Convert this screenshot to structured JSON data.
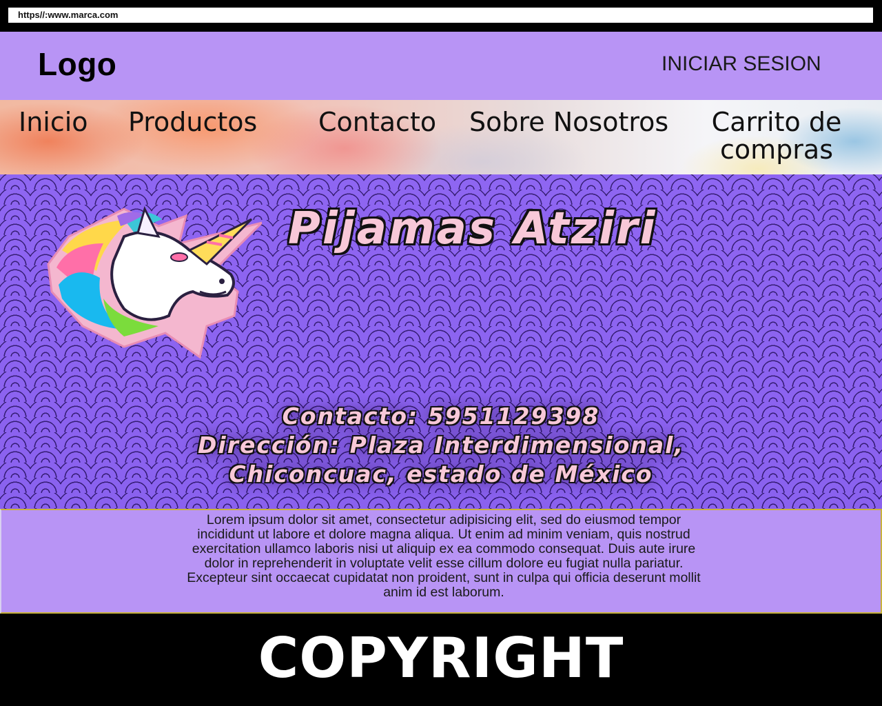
{
  "browser": {
    "url": "https//:www.marca.com"
  },
  "header": {
    "logo": "Logo",
    "login": "INICIAR SESION"
  },
  "nav": {
    "items": [
      {
        "label": "Inicio"
      },
      {
        "label": "Productos"
      },
      {
        "label": "Contacto"
      },
      {
        "label": "Sobre Nosotros"
      },
      {
        "label": "Carrito de compras"
      }
    ]
  },
  "hero": {
    "title": "Pijamas Atziri",
    "contact_line": "Contacto: 5951129398",
    "address_line1": "Dirección: Plaza Interdimensional,",
    "address_line2": "Chiconcuac, estado de México",
    "icon": "unicorn-logo-icon"
  },
  "content": {
    "lorem": "Lorem ipsum dolor sit amet, consectetur adipisicing elit, sed do eiusmod tempor incididunt ut labore et dolore magna aliqua. Ut enim ad minim veniam, quis nostrud exercitation ullamco laboris nisi ut aliquip ex ea commodo consequat. Duis aute irure dolor in reprehenderit in voluptate velit esse cillum dolore eu fugiat nulla pariatur. Excepteur sint occaecat cupidatat non proident, sunt in culpa qui officia deserunt mollit anim id est laborum."
  },
  "footer": {
    "copyright": "COPYRIGHT"
  },
  "colors": {
    "header_bg": "#b894f5",
    "hero_bg": "#8f66f0",
    "title_pink": "#f8c8d8",
    "footer_bg": "#000000"
  }
}
